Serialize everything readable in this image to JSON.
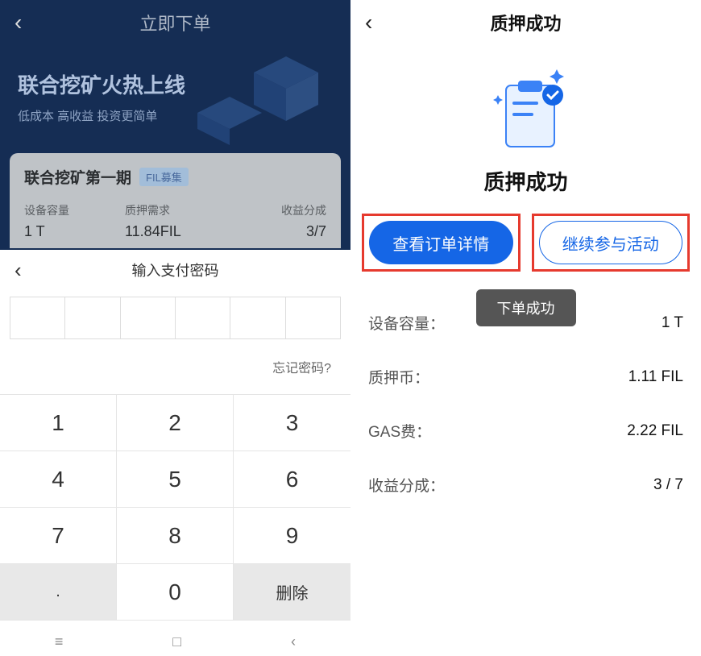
{
  "left": {
    "header_title": "立即下单",
    "banner_title": "联合挖矿火热上线",
    "banner_sub": "低成本 高收益 投资更简单",
    "card_title": "联合挖矿第一期",
    "card_badge": "FIL募集",
    "stats": [
      {
        "label": "设备容量",
        "value": "1 T"
      },
      {
        "label": "质押需求",
        "value": "11.84FIL"
      },
      {
        "label": "收益分成",
        "value": "3/7"
      }
    ],
    "sheet_title": "输入支付密码",
    "forgot": "忘记密码?",
    "keys": [
      "1",
      "2",
      "3",
      "4",
      "5",
      "6",
      "7",
      "8",
      "9",
      ".",
      "0",
      "删除"
    ]
  },
  "right": {
    "header_title": "质押成功",
    "success_label": "质押成功",
    "btn_primary": "查看订单详情",
    "btn_outline": "继续参与活动",
    "toast": "下单成功",
    "details": [
      {
        "label": "设备容量：",
        "value": "1 T"
      },
      {
        "label": "质押币：",
        "value": "1.11 FIL"
      },
      {
        "label": "GAS费：",
        "value": "2.22 FIL"
      },
      {
        "label": "收益分成：",
        "value": "3 / 7"
      }
    ]
  }
}
